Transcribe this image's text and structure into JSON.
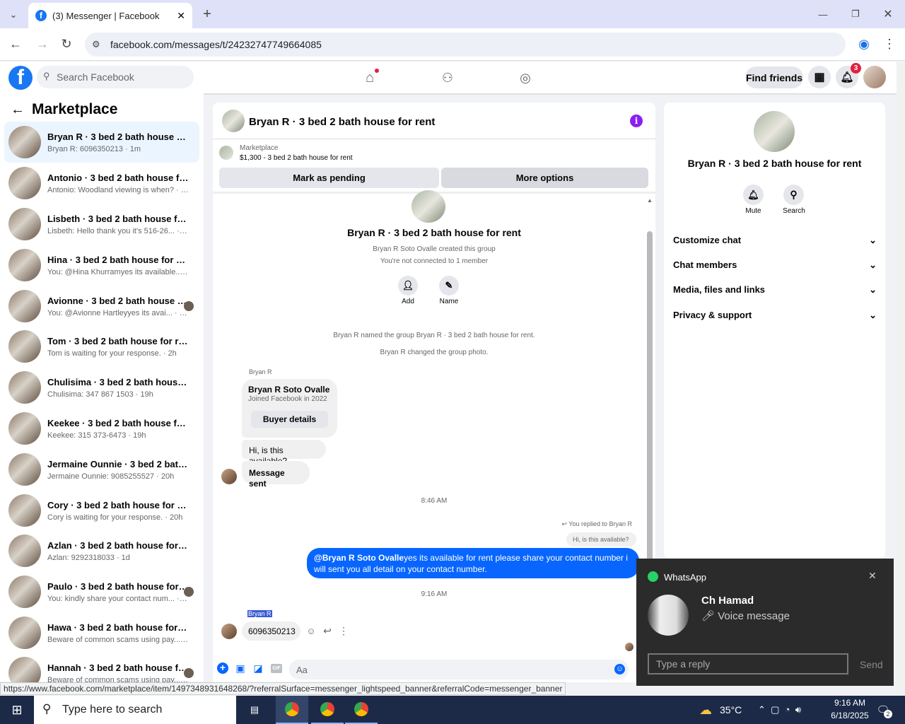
{
  "browser": {
    "tab_title": "(3) Messenger | Facebook",
    "url": "facebook.com/messages/t/24232747749664085"
  },
  "fb": {
    "search_placeholder": "Search Facebook",
    "find_friends": "Find friends",
    "notif_count": "3"
  },
  "left": {
    "title": "Marketplace",
    "items": [
      {
        "name": "Bryan R · 3 bed 2 bath house for r...",
        "msg": "Bryan R: 6096350213 · 1m"
      },
      {
        "name": "Antonio · 3 bed 2 bath house for r...",
        "msg": "Antonio: Woodland viewing is when? · 20m"
      },
      {
        "name": "Lisbeth · 3 bed 2 bath house for rent",
        "msg": "Lisbeth: Hello thank you it's 516-26... · 26m"
      },
      {
        "name": "Hina · 3 bed 2 bath house for rent",
        "msg": "You: @Hina Khurramyes its available... · 27m"
      },
      {
        "name": "Avionne · 3 bed 2 bath house fo...",
        "msg": "You: @Avionne Hartleyyes its avai... · 27m"
      },
      {
        "name": "Tom · 3 bed 2 bath house for rent",
        "msg": "Tom is waiting for your response. · 2h"
      },
      {
        "name": "Chulisima · 3 bed 2 bath house for...",
        "msg": "Chulisima: 347 867 1503 · 19h"
      },
      {
        "name": "Keekee · 3 bed 2 bath house for rent",
        "msg": "Keekee: 315 373-6473 · 19h"
      },
      {
        "name": "Jermaine Ounnie · 3 bed 2 bath ho...",
        "msg": "Jermaine Ounnie: 9085255527 · 20h"
      },
      {
        "name": "Cory · 3 bed 2 bath house for rent",
        "msg": "Cory is waiting for your response. · 20h"
      },
      {
        "name": "Azlan · 3 bed 2 bath house for rent",
        "msg": "Azlan: 9292318033 · 1d"
      },
      {
        "name": "Paulo · 3 bed 2 bath house for r...",
        "msg": "You: kindly share your contact num... · 1d"
      },
      {
        "name": "Hawa · 3 bed 2 bath house for rent",
        "msg": "Beware of common scams using pay... · 1d"
      },
      {
        "name": "Hannah · 3 bed 2 bath house for...",
        "msg": "Beware of common scams using pay... · 1d"
      }
    ]
  },
  "chat": {
    "header_title": "Bryan R · 3 bed 2 bath house for rent",
    "marketplace_label": "Marketplace",
    "listing": "$1,300 - 3 bed 2 bath house for rent",
    "mark_pending": "Mark as pending",
    "more_options": "More options",
    "group_title": "Bryan R · 3 bed 2 bath house for rent",
    "created": "Bryan R Soto Ovalle created this group",
    "not_connected": "You're not connected to 1 member",
    "add_label": "Add",
    "name_label": "Name",
    "event1": "Bryan R named the group Bryan R · 3 bed 2 bath house for rent.",
    "event2": "Bryan R changed the group photo.",
    "sender": "Bryan R",
    "card_name": "Bryan R Soto Ovalle",
    "card_sub": "Joined Facebook in 2022",
    "buyer_details": "Buyer details",
    "msg_avail": "Hi, is this available?",
    "msg_sent": "Message sent",
    "time1": "8:46 AM",
    "replied": "You replied to Bryan R",
    "quoted": "Hi, is this available?",
    "mention": "@Bryan R Soto Ovalle",
    "reply_text": "yes its available for rent please share your contact number i will sent you all detail on your contact number.",
    "time2": "9:16 AM",
    "sender2": "Bryan R",
    "phone": "6096350213",
    "input_placeholder": "Aa"
  },
  "right": {
    "title": "Bryan R · 3 bed 2 bath house for rent",
    "mute": "Mute",
    "search": "Search",
    "sections": [
      "Customize chat",
      "Chat members",
      "Media, files and links",
      "Privacy & support"
    ]
  },
  "whatsapp": {
    "app": "WhatsApp",
    "contact": "Ch Hamad",
    "message": "Voice message",
    "reply_placeholder": "Type a reply",
    "send": "Send"
  },
  "statusbar": "https://www.facebook.com/marketplace/item/1497348931648268/?referralSurface=messenger_lightspeed_banner&referralCode=messenger_banner",
  "taskbar": {
    "search": "Type here to search",
    "temp": "35°C",
    "time": "9:16 AM",
    "date": "6/18/2025",
    "notif": "2"
  },
  "colors": {
    "fb_blue": "#1877f2",
    "bubble_blue": "#0866ff",
    "purple": "#8b1ff2"
  }
}
